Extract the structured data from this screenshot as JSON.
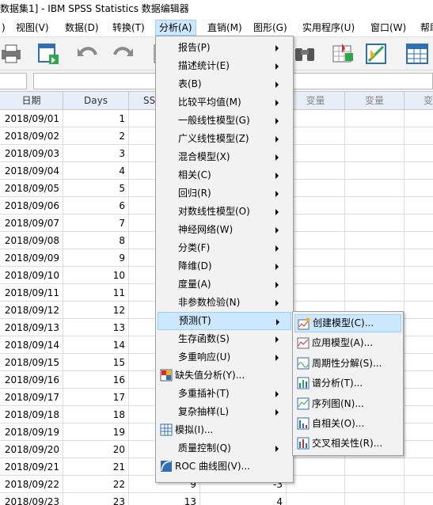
{
  "window": {
    "title": "数据集1] - IBM SPSS Statistics 数据编辑器"
  },
  "menubar": [
    {
      "label": "件(F)",
      "x": -6
    },
    {
      "label": "编辑(E)"
    },
    {
      "label": "视图(V)"
    },
    {
      "label": "数据(D)"
    },
    {
      "label": "转换(T)"
    },
    {
      "label": "分析(A)"
    },
    {
      "label": "直销(M)"
    },
    {
      "label": "图形(G)"
    },
    {
      "label": "实用程序(U)"
    },
    {
      "label": "窗口(W)"
    },
    {
      "label": "帮助"
    }
  ],
  "menubar_visible": [
    "视图(V)",
    "数据(D)",
    "转换(T)",
    "分析(A)",
    "直销(M)",
    "图形(G)",
    "实用程序(U)",
    "窗口(W)",
    "帮助"
  ],
  "grid": {
    "columns": [
      "日期",
      "Days",
      "SS",
      "变量",
      "变量",
      "变"
    ],
    "rows": [
      [
        "2018/09/01",
        "1"
      ],
      [
        "2018/09/02",
        "2"
      ],
      [
        "2018/09/03",
        "3"
      ],
      [
        "2018/09/04",
        "4"
      ],
      [
        "2018/09/05",
        "5"
      ],
      [
        "2018/09/06",
        "6"
      ],
      [
        "2018/09/07",
        "7"
      ],
      [
        "2018/09/08",
        "8"
      ],
      [
        "2018/09/09",
        "9"
      ],
      [
        "2018/09/10",
        "10"
      ],
      [
        "2018/09/11",
        "11"
      ],
      [
        "2018/09/12",
        "12"
      ],
      [
        "2018/09/13",
        "13"
      ],
      [
        "2018/09/14",
        "14"
      ],
      [
        "2018/09/15",
        "15"
      ],
      [
        "2018/09/16",
        "16"
      ],
      [
        "2018/09/17",
        "17"
      ],
      [
        "2018/09/18",
        "18"
      ],
      [
        "2018/09/19",
        "19"
      ],
      [
        "2018/09/20",
        "20"
      ],
      [
        "2018/09/21",
        "21"
      ],
      [
        "2018/09/22",
        "22"
      ],
      [
        "2018/09/23",
        "23"
      ]
    ],
    "row22_extra": [
      "9",
      "-3"
    ],
    "row23_extra": [
      "13",
      "4"
    ]
  },
  "analyze_menu": [
    {
      "label": "报告(P)",
      "submenu": true
    },
    {
      "label": "描述统计(E)",
      "submenu": true
    },
    {
      "label": "表(B)",
      "submenu": true
    },
    {
      "label": "比较平均值(M)",
      "submenu": true
    },
    {
      "label": "一般线性模型(G)",
      "submenu": true
    },
    {
      "label": "广义线性模型(Z)",
      "submenu": true
    },
    {
      "label": "混合模型(X)",
      "submenu": true
    },
    {
      "label": "相关(C)",
      "submenu": true
    },
    {
      "label": "回归(R)",
      "submenu": true
    },
    {
      "label": "对数线性模型(O)",
      "submenu": true
    },
    {
      "label": "神经网络(W)",
      "submenu": true
    },
    {
      "label": "分类(F)",
      "submenu": true
    },
    {
      "label": "降维(D)",
      "submenu": true
    },
    {
      "label": "度量(A)",
      "submenu": true
    },
    {
      "label": "非参数检验(N)",
      "submenu": true
    },
    {
      "label": "预测(T)",
      "submenu": true,
      "highlighted": true
    },
    {
      "label": "生存函数(S)",
      "submenu": true
    },
    {
      "label": "多重响应(U)",
      "submenu": true
    },
    {
      "label": "缺失值分析(Y)...",
      "icon": "missing-value-icon"
    },
    {
      "label": "多重插补(T)",
      "submenu": true
    },
    {
      "label": "复杂抽样(L)",
      "submenu": true
    },
    {
      "label": "模拟(I)...",
      "icon": "simulation-icon"
    },
    {
      "label": "质量控制(Q)",
      "submenu": true
    },
    {
      "label": "ROC 曲线图(V)...",
      "icon": "roc-curve-icon"
    }
  ],
  "forecast_menu": [
    {
      "label": "创建模型(C)...",
      "icon": "create-model-icon",
      "highlighted": true
    },
    {
      "label": "应用模型(A)...",
      "icon": "apply-model-icon"
    },
    {
      "label": "周期性分解(S)...",
      "icon": "seasonal-decompose-icon"
    },
    {
      "label": "谱分析(T)...",
      "icon": "spectral-analysis-icon"
    },
    {
      "label": "序列图(N)...",
      "icon": "sequence-chart-icon"
    },
    {
      "label": "自相关(O)...",
      "icon": "autocorrelation-icon"
    },
    {
      "label": "交叉相关性(R)...",
      "icon": "cross-correlation-icon"
    }
  ],
  "colors": {
    "highlight": "#cce8ff",
    "highlight_border": "#99d1ff",
    "header_bg": "#e8eef7"
  }
}
